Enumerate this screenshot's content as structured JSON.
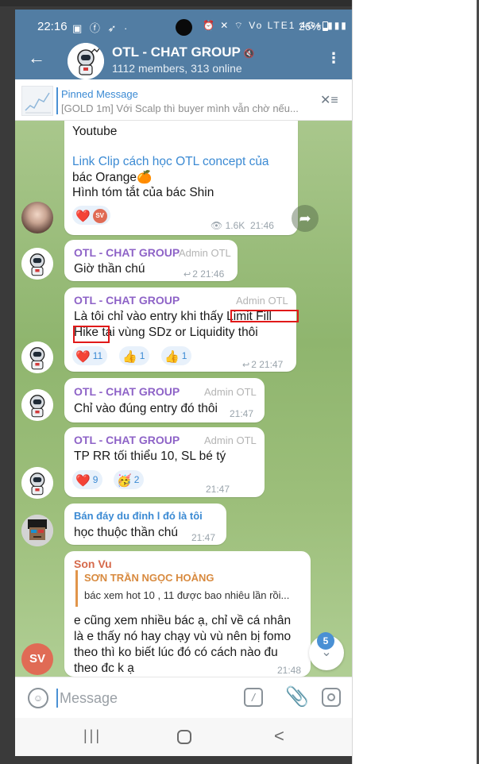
{
  "status_bar": {
    "time": "22:16",
    "left_icons": "▣ ⓕ ➶ ·",
    "right_icons": "⏰ ✕ ⌔ Vo LTE1 4G+ ▮▮▮",
    "battery": "26%"
  },
  "header": {
    "back_icon": "←",
    "title": "OTL - CHAT GROUP",
    "mute_icon": "🔇",
    "subtitle": "1112 members, 313 online",
    "menu_icon": "⋮"
  },
  "pinned": {
    "title": "Pinned Message",
    "text": "[GOLD 1m] Với Scalp thì buyer mình vẫn chờ nếu...",
    "icon": "✕≡"
  },
  "messages": {
    "m1": {
      "line0": "Youtube",
      "link": "Link Clip cách học OTL concept của",
      "line2": "bác Orange🍊",
      "line3": "Hình tóm tắt của bác Shin",
      "views": "1.6K",
      "time": "21:46",
      "react_heart": "❤️",
      "react_sv": "SV"
    },
    "m2": {
      "sender": "OTL - CHAT GROUP",
      "admin": "Admin OTL",
      "text": "Giờ thần chú",
      "replies": "2",
      "time": "21:46"
    },
    "m3": {
      "sender": "OTL - CHAT GROUP",
      "admin": "Admin OTL",
      "line1": "Là tôi chỉ vào entry khi thấy Limit Fill",
      "line2": "Hike tại vùng SDz or Liquidity thôi",
      "r1_emoji": "❤️",
      "r1_count": "11",
      "r2_emoji": "👍",
      "r2_count": "1",
      "r3_emoji": "👍",
      "r3_count": "1",
      "replies": "2",
      "time": "21:47"
    },
    "m4": {
      "sender": "OTL - CHAT GROUP",
      "admin": "Admin OTL",
      "text": "Chỉ vào đúng entry đó thôi",
      "time": "21:47"
    },
    "m5": {
      "sender": "OTL - CHAT GROUP",
      "admin": "Admin OTL",
      "text": "TP RR tối thiểu 10, SL bé tý",
      "r1_emoji": "❤️",
      "r1_count": "9",
      "r2_emoji": "🥳",
      "r2_count": "2",
      "time": "21:47"
    },
    "m6": {
      "sender": "Bán đáy du đỉnh l đó là tôi",
      "text": "học thuộc thần chú",
      "time": "21:47"
    },
    "m7": {
      "sender": "Son Vu",
      "quote_name": "SƠN TRẦN NGỌC HOÀNG",
      "quote_text": "bác xem hot 10 , 11 được bao nhiêu lần rồi...",
      "line1": "e cũng xem nhiều bác ạ, chỉ về cá nhân",
      "line2": "là e thấy nó hay chạy vù vù nên bị fomo",
      "line3": "theo thì ko biết lúc đó có cách nào đu",
      "line4": "theo đc k ạ",
      "time": "21:48"
    }
  },
  "avatars": {
    "sv_initials": "SV"
  },
  "scroll": {
    "unread_count": "5",
    "icon": "⌄"
  },
  "input": {
    "placeholder": "Message",
    "emoji_icon": "☺",
    "cmd_icon": "/",
    "attach_icon": "📎"
  },
  "navbar": {
    "recent_icon": "|||",
    "back_icon": "<"
  }
}
